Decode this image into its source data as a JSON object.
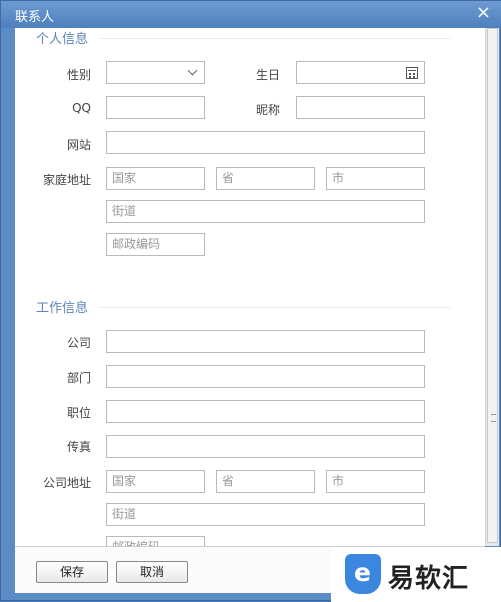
{
  "window": {
    "title": "联系人",
    "close": "×"
  },
  "personal": {
    "section": "个人信息",
    "gender_label": "性别",
    "gender_value": "",
    "birthday_label": "生日",
    "birthday_value": "",
    "qq_label": "QQ",
    "qq_value": "",
    "nickname_label": "昵称",
    "nickname_value": "",
    "website_label": "网站",
    "website_value": "",
    "home_address_label": "家庭地址",
    "country_placeholder": "国家",
    "province_placeholder": "省",
    "city_placeholder": "市",
    "street_placeholder": "街道",
    "postal_placeholder": "邮政编码"
  },
  "work": {
    "section": "工作信息",
    "company_label": "公司",
    "company_value": "",
    "department_label": "部门",
    "department_value": "",
    "position_label": "职位",
    "position_value": "",
    "fax_label": "传真",
    "fax_value": "",
    "work_address_label": "公司地址",
    "country_placeholder": "国家",
    "province_placeholder": "省",
    "city_placeholder": "市",
    "street_placeholder": "街道",
    "postal_placeholder": "邮政编码"
  },
  "buttons": {
    "save": "保存",
    "cancel": "取消"
  },
  "watermark": {
    "name": "易软汇",
    "icon": "shield-e-icon",
    "color": "#3b87e0"
  }
}
